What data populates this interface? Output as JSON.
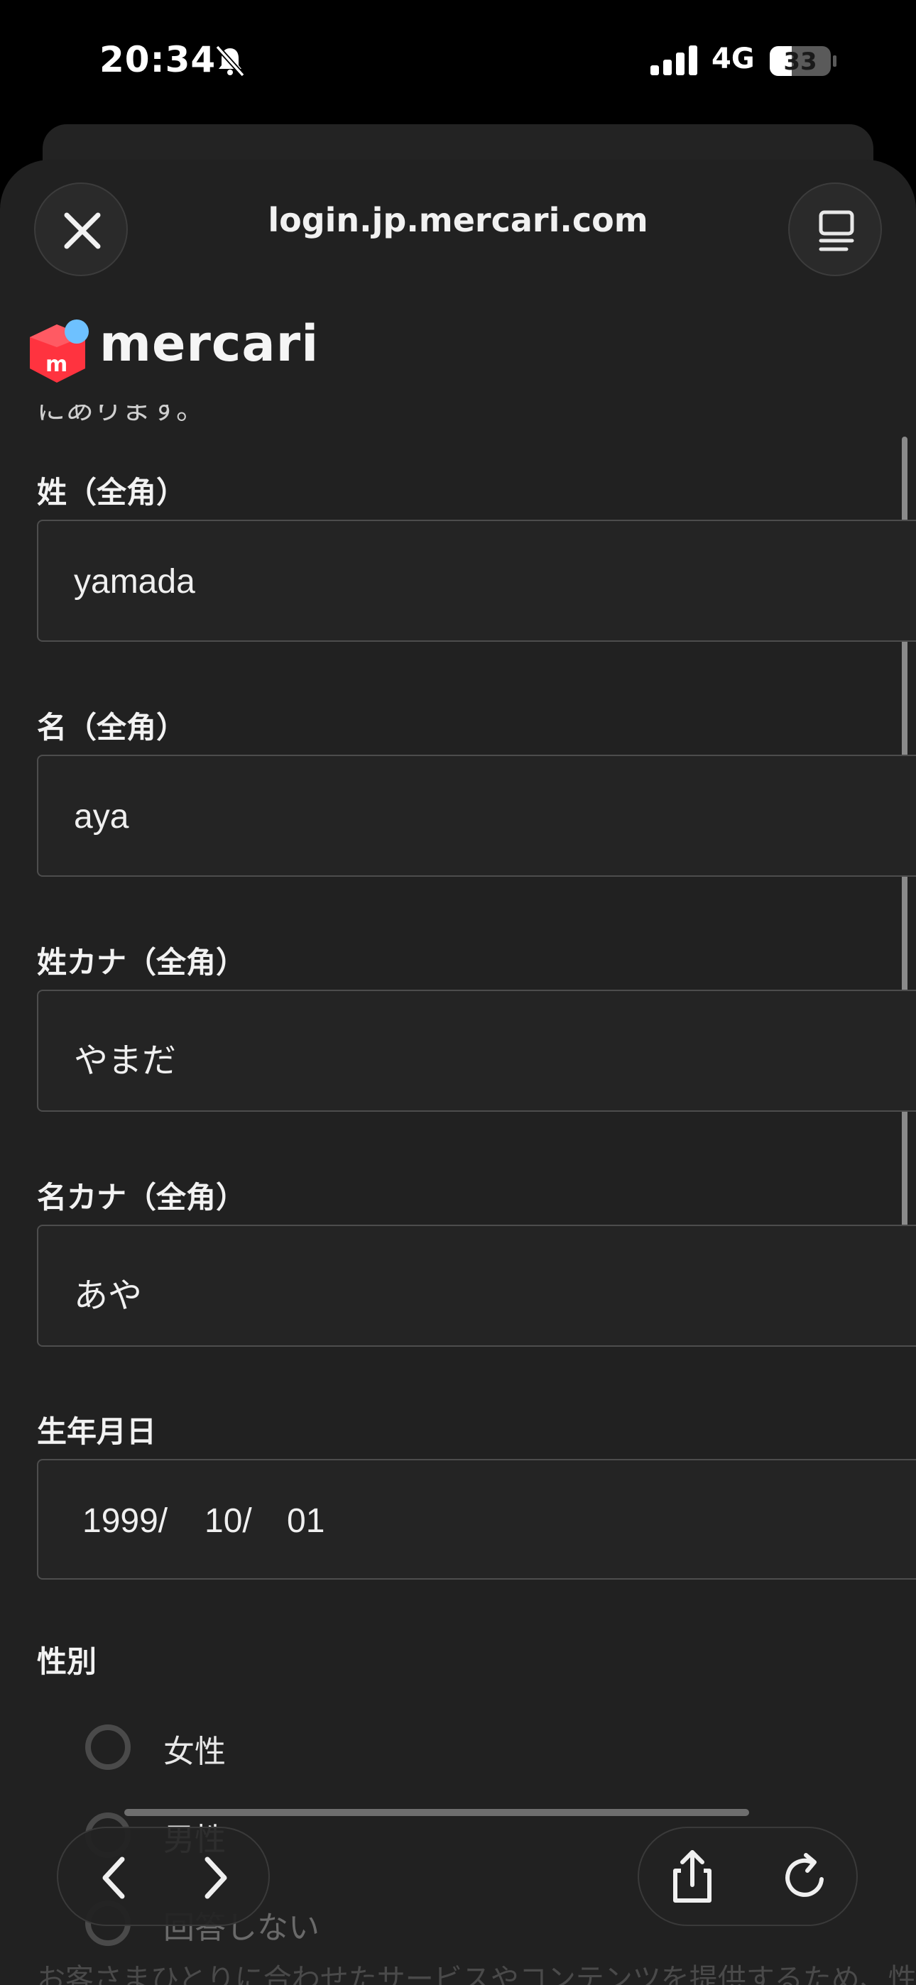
{
  "status_bar": {
    "time": "20:34",
    "network": "4G",
    "battery": "33",
    "icons": [
      "bell-muted-icon",
      "signal-icon",
      "battery-icon"
    ]
  },
  "browser": {
    "url": "login.jp.mercari.com",
    "icons": [
      "close-icon",
      "reader-icon",
      "back-icon",
      "forward-icon",
      "share-icon",
      "reload-icon"
    ]
  },
  "brand": {
    "name": "mercari",
    "logo_color": "#ff333f",
    "dot_color": "#6ec1ff"
  },
  "page": {
    "cut_text": "にあります。"
  },
  "form": {
    "last_name": {
      "label": "姓（全角）",
      "value": "yamada"
    },
    "first_name": {
      "label": "名（全角）",
      "value": "aya"
    },
    "last_name_kana": {
      "label": "姓カナ（全角）",
      "value": "やまだ"
    },
    "first_name_kana": {
      "label": "名カナ（全角）",
      "value": "あや"
    },
    "birthday": {
      "label": "生年月日",
      "year": "1999/",
      "month": "10/",
      "day": "01"
    },
    "gender": {
      "label": "性別",
      "options": [
        "女性",
        "男性",
        "回答しない"
      ]
    }
  },
  "footer_text": "お客さまひとりに合わせたサービスやコンテンツを提供するため、性別"
}
